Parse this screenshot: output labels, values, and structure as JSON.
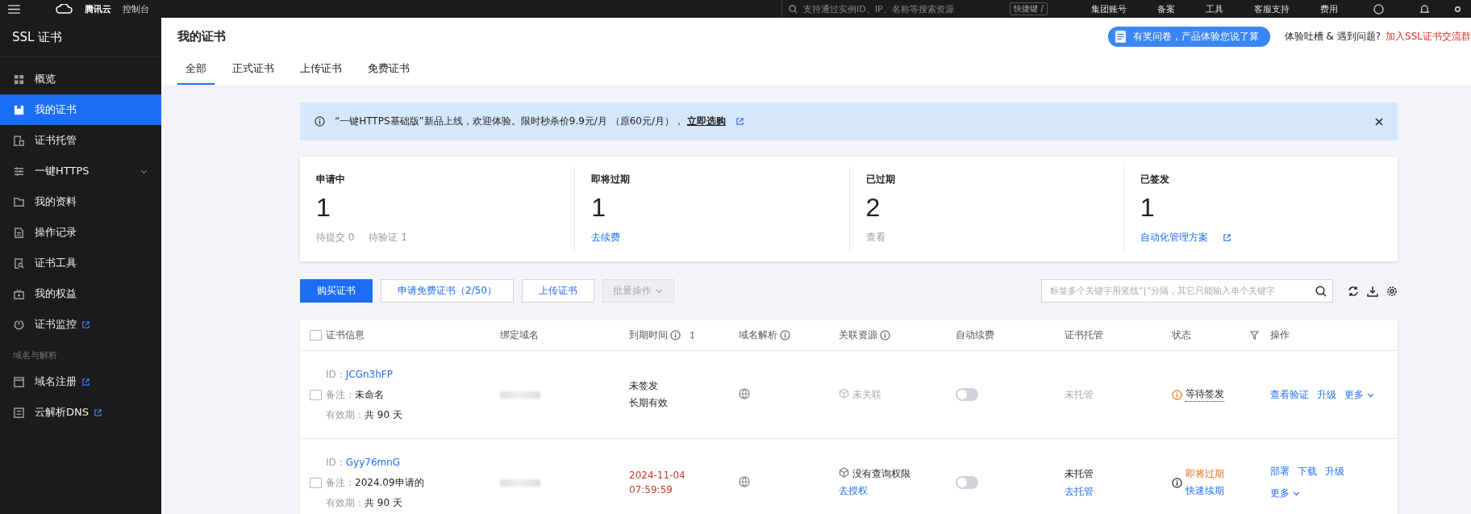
{
  "top_bar": {
    "brand": "腾讯云",
    "console": "控制台",
    "search": {
      "placeholder": "支持通过实例ID、IP、名称等搜索资源"
    },
    "shortcut": "快捷键 /",
    "links": [
      "集团账号",
      "备案",
      "工具",
      "客服支持",
      "费用"
    ]
  },
  "sidebar": {
    "title": "SSL 证书",
    "groups": [
      {
        "items": [
          {
            "label": "概览",
            "selected": false,
            "external": false,
            "kind": "page"
          },
          {
            "label": "我的证书",
            "selected": true,
            "external": false,
            "kind": "page"
          },
          {
            "label": "证书托管",
            "selected": false,
            "external": false,
            "kind": "page"
          },
          {
            "label": "一键HTTPS",
            "selected": false,
            "external": false,
            "kind": "submenu"
          },
          {
            "label": "我的资料",
            "selected": false,
            "external": false,
            "kind": "page"
          },
          {
            "label": "操作记录",
            "selected": false,
            "external": false,
            "kind": "page"
          },
          {
            "label": "证书工具",
            "selected": false,
            "external": false,
            "kind": "page"
          },
          {
            "label": "我的权益",
            "selected": false,
            "external": false,
            "kind": "page"
          },
          {
            "label": "证书监控",
            "selected": false,
            "external": true,
            "kind": "page"
          }
        ]
      },
      {
        "heading": "域名与解析",
        "items": [
          {
            "label": "域名注册",
            "selected": false,
            "external": true,
            "kind": "page"
          },
          {
            "label": "云解析DNS",
            "selected": false,
            "external": true,
            "kind": "page"
          }
        ]
      }
    ]
  },
  "header": {
    "title": "我的证书",
    "tabs": [
      {
        "label": "全部",
        "selected": true
      },
      {
        "label": "正式证书",
        "selected": false
      },
      {
        "label": "上传证书",
        "selected": false
      },
      {
        "label": "免费证书",
        "selected": false
      }
    ],
    "survey": "有奖问卷，产品体验您说了算",
    "feedback": "体验吐槽 & 遇到问题?",
    "community_link": "加入SSL证书交流群"
  },
  "notice": {
    "text": "“一键HTTPS基础版”新品上线，欢迎体验。限时秒杀价9.9元/月 （原60元/月），",
    "link": "立即选购"
  },
  "stats": [
    {
      "label": "申请中",
      "value": "1",
      "footer": [
        {
          "text": "待提交 0",
          "kind": "muted"
        },
        {
          "text": "待验证 1",
          "kind": "muted"
        }
      ],
      "external": false
    },
    {
      "label": "即将过期",
      "value": "1",
      "footer": [
        {
          "text": "去续费",
          "kind": "link"
        }
      ],
      "external": false
    },
    {
      "label": "已过期",
      "value": "2",
      "footer": [
        {
          "text": "查看",
          "kind": "muted"
        }
      ],
      "external": false
    },
    {
      "label": "已签发",
      "value": "1",
      "footer": [
        {
          "text": "自动化管理方案",
          "kind": "link"
        }
      ],
      "external": true
    }
  ],
  "toolbar": {
    "buttons": [
      {
        "label": "购买证书",
        "kind": "primary",
        "disabled": false
      },
      {
        "label": "申请免费证书（2/50）",
        "kind": "outline",
        "disabled": false
      },
      {
        "label": "上传证书",
        "kind": "outline",
        "disabled": false
      },
      {
        "label": "批量操作",
        "kind": "dropdown",
        "disabled": true
      }
    ],
    "search": {
      "placeholder": "标签多个关键字用竖线“|”分隔，其它只能输入单个关键字"
    }
  },
  "table": {
    "select_all": {
      "checked": false
    },
    "columns": [
      {
        "label": "证书信息",
        "info": false,
        "sort": false,
        "filter": false
      },
      {
        "label": "绑定域名",
        "info": false,
        "sort": false,
        "filter": false
      },
      {
        "label": "到期时间",
        "info": true,
        "sort": true,
        "filter": false
      },
      {
        "label": "域名解析",
        "info": true,
        "sort": false,
        "filter": false
      },
      {
        "label": "关联资源",
        "info": true,
        "sort": false,
        "filter": false
      },
      {
        "label": "自动续费",
        "info": false,
        "sort": false,
        "filter": false
      },
      {
        "label": "证书托管",
        "info": false,
        "sort": false,
        "filter": false
      },
      {
        "label": "状态",
        "info": false,
        "sort": false,
        "filter": true
      },
      {
        "label": "操作",
        "info": false,
        "sort": false,
        "filter": false
      }
    ],
    "rows": [
      {
        "checked": false,
        "info": [
          {
            "label": "ID：",
            "value": "JCGn3hFP",
            "kind": "link"
          },
          {
            "label": "备注：",
            "value": "未命名",
            "kind": "text"
          },
          {
            "label": "有效期：",
            "value": "共 90 天",
            "kind": "text"
          }
        ],
        "expiry": {
          "lines": [
            "未签发",
            "长期有效"
          ],
          "kind": "normal"
        },
        "resource": {
          "text": "未关联",
          "kind": "none"
        },
        "auto_renew": {
          "on": false
        },
        "hosting": {
          "text": "未托管",
          "muted": true
        },
        "status": {
          "text": "等待签发",
          "kind": "pending"
        },
        "action_lines": [
          [
            {
              "label": "查看验证",
              "kind": "link"
            },
            {
              "label": "升级",
              "kind": "link"
            },
            {
              "label": "更多",
              "kind": "menu"
            }
          ]
        ]
      },
      {
        "checked": false,
        "info": [
          {
            "label": "ID：",
            "value": "Gyy76mnG",
            "kind": "link"
          },
          {
            "label": "备注：",
            "value": "2024.09申请的",
            "kind": "text"
          },
          {
            "label": "有效期：",
            "value": "共 90 天",
            "kind": "text"
          }
        ],
        "expiry": {
          "lines": [
            "2024-11-04",
            "07:59:59"
          ],
          "kind": "expiring"
        },
        "resource": {
          "text": "没有查询权限",
          "kind": "denied",
          "link": "去授权"
        },
        "auto_renew": {
          "on": false
        },
        "hosting": {
          "text": "未托管",
          "muted": false,
          "link": "去托管"
        },
        "status": {
          "text": "即将过期",
          "kind": "expiring",
          "link": "快速续期"
        },
        "action_lines": [
          [
            {
              "label": "部署",
              "kind": "link"
            },
            {
              "label": "下载",
              "kind": "link"
            },
            {
              "label": "升级",
              "kind": "link"
            }
          ],
          [
            {
              "label": "更多",
              "kind": "menu"
            }
          ]
        ]
      }
    ]
  }
}
